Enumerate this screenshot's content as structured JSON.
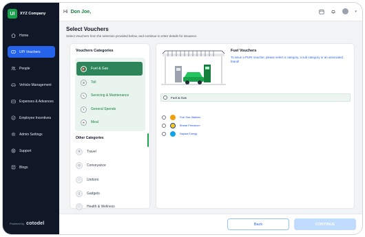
{
  "app": {
    "logo_text": "UI",
    "company": "XYZ Company"
  },
  "sidebar": {
    "items": [
      {
        "label": "Home",
        "icon": "home-icon"
      },
      {
        "label": "UPI Vouchers",
        "icon": "voucher-icon",
        "active": true
      },
      {
        "label": "People",
        "icon": "people-icon"
      },
      {
        "label": "Vehicle Management",
        "icon": "vehicle-icon"
      },
      {
        "label": "Expenses & Advances",
        "icon": "wallet-icon"
      },
      {
        "label": "Employee Incentives",
        "icon": "incentive-icon"
      },
      {
        "label": "Admin Settings",
        "icon": "gear-icon"
      },
      {
        "label": "Support",
        "icon": "support-icon"
      },
      {
        "label": "Blogs",
        "icon": "blog-icon"
      }
    ],
    "powered_by": "Powered by",
    "powered_brand": "cotodel"
  },
  "header": {
    "greeting": "Hi",
    "user_name": "Don Joe,"
  },
  "page": {
    "title": "Select Vouchers",
    "subtitle": "Select Vouchers from the selection provided below, and continue to enter details for issuance."
  },
  "voucher_categories": {
    "title": "Vouchers Categories",
    "items": [
      {
        "label": "Fuel & Gas",
        "selected": true
      },
      {
        "label": "Toll"
      },
      {
        "label": "Servicing & Maintenance"
      },
      {
        "label": "General Spends"
      },
      {
        "label": "Meal"
      }
    ]
  },
  "other_categories": {
    "title": "Other Categories",
    "items": [
      {
        "label": "Travel"
      },
      {
        "label": "Conveyance"
      },
      {
        "label": "Uniform"
      },
      {
        "label": "Gadgets"
      },
      {
        "label": "Health & Wellness"
      }
    ]
  },
  "detail": {
    "title": "Fuel Vouchers",
    "description": "To issue a PURI Voucher, please select a category, a sub-category or an associated brand!",
    "selected_option": "Fuel & Gas",
    "sub_options": [
      {
        "label": "Fuel Gas Stations",
        "color": "#f59e0b"
      },
      {
        "label": "Bharat Petroleum",
        "color": "#1e40af"
      },
      {
        "label": "Nayara Energy",
        "color": "#0ea5e9"
      }
    ]
  },
  "footer": {
    "back_label": "Back",
    "continue_label": "CONTINUE"
  },
  "colors": {
    "sidebar_bg": "#101828",
    "accent_blue": "#2563eb",
    "accent_green": "#2f855a"
  }
}
